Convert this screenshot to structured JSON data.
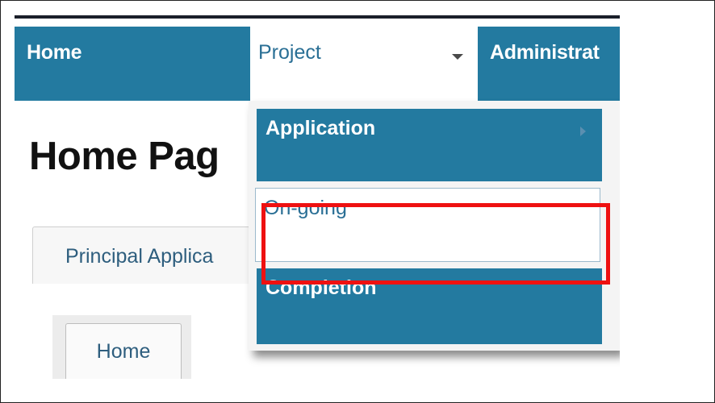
{
  "navbar": {
    "home_label": "Home",
    "project_label": "Project",
    "administration_label": "Administrat"
  },
  "page": {
    "title": "Home Pag"
  },
  "tabs": {
    "principal_label": "Principal Applica",
    "home_label": "Home"
  },
  "dropdown": {
    "items": [
      {
        "label": "Application",
        "has_submenu": true
      },
      {
        "label": "On-going",
        "highlighted": true
      },
      {
        "label": "Completion"
      }
    ]
  },
  "colors": {
    "nav_bg": "#237aa0",
    "highlight_border": "#ee1111",
    "link_text": "#2a6f95"
  }
}
